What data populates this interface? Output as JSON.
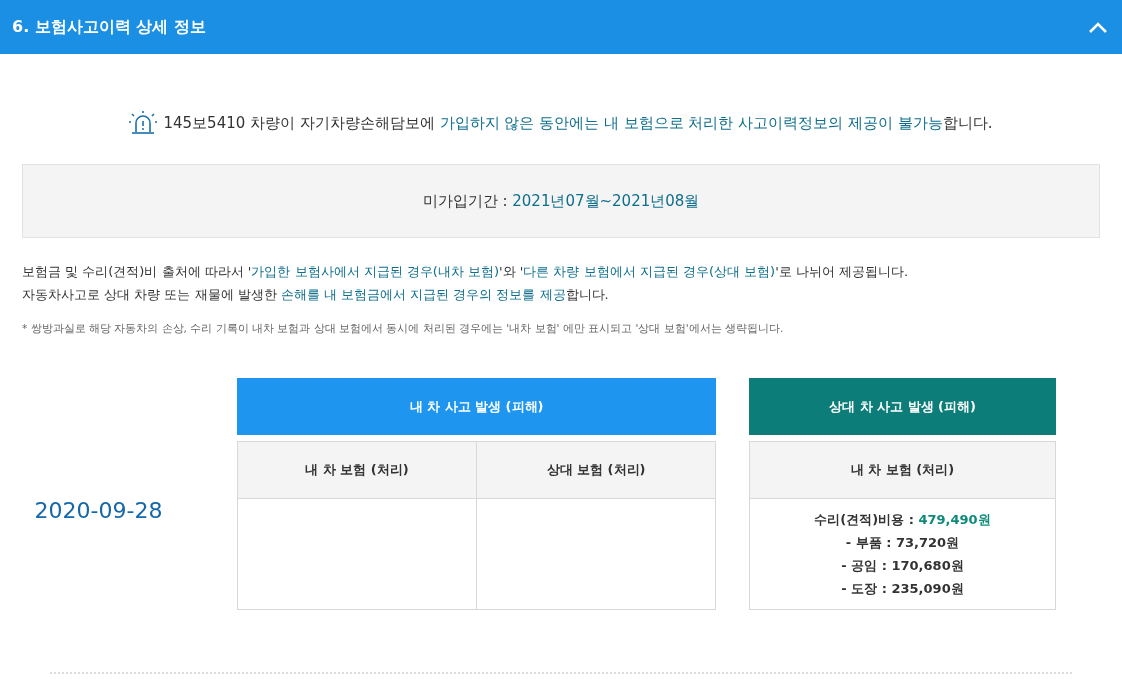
{
  "header": {
    "title": "6. 보험사고이력 상세 정보",
    "expanded": true
  },
  "notice": [
    {
      "text": "145보5410 차량이 자기차량손해담보에 ",
      "highlight": false
    },
    {
      "text": "가입하지 않은 동안에는 내 보험으로 처리한 사고이력정보의 제공이 불가능",
      "highlight": true
    },
    {
      "text": "합니다.",
      "highlight": false
    }
  ],
  "period": {
    "label": "미가입기간 : ",
    "value": "2021년07월~2021년08월"
  },
  "description": [
    [
      {
        "text": "보험금 및 수리(견적)비 출처에 따라서 '",
        "highlight": false
      },
      {
        "text": "가입한 보험사에서 지급된 경우(내차 보험)",
        "highlight": true
      },
      {
        "text": "'와 '",
        "highlight": false
      },
      {
        "text": "다른 차량 보험에서 지급된 경우(상대 보험)",
        "highlight": true
      },
      {
        "text": "'로 나뉘어 제공됩니다.",
        "highlight": false
      }
    ],
    [
      {
        "text": "자동차사고로 상대 차량 또는 재물에 발생한 ",
        "highlight": false
      },
      {
        "text": "손해를 내 보험금에서 지급된 경우의 정보를 제공",
        "highlight": true
      },
      {
        "text": "합니다.",
        "highlight": false
      }
    ]
  ],
  "footnote": "* 쌍방과실로 해당 자동차의 손상, 수리 기록이 내차 보험과 상대 보험에서 동시에 처리된 경우에는 '내차 보험' 에만 표시되고 '상대 보험'에서는 생략됩니다.",
  "record": {
    "date": "2020-09-28",
    "groups": [
      {
        "title": "내 차 사고 발생 (피해)",
        "color": "#1e96f0",
        "columns": [
          {
            "heading": "내 차 보험 (처리)"
          },
          {
            "heading": "상대 보험 (처리)"
          }
        ]
      },
      {
        "title": "상대 차 사고 발생 (피해)",
        "color": "#0d7d7a",
        "columns": [
          {
            "heading": "내 차 보험 (처리)",
            "lines": [
              {
                "label": "수리(견적)비용 : ",
                "value": "479,490원",
                "highlight": true
              },
              {
                "label": "- 부품 : ",
                "value": "73,720원",
                "highlight": false
              },
              {
                "label": "- 공임 : ",
                "value": "170,680원",
                "highlight": false
              },
              {
                "label": "- 도장 : ",
                "value": "235,090원",
                "highlight": false
              }
            ]
          }
        ]
      }
    ]
  }
}
